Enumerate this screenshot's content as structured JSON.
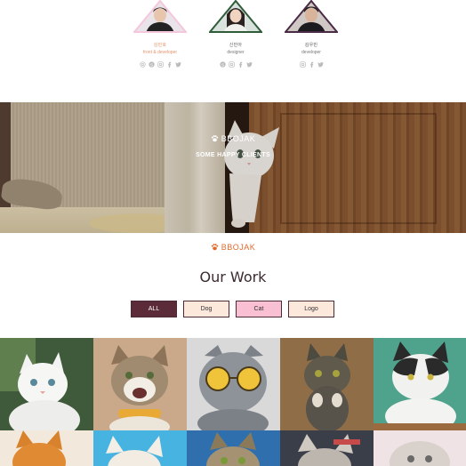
{
  "team": {
    "members": [
      {
        "name": "김민호",
        "role": "front & developer",
        "border": "#f4c7dc",
        "icons": [
          "instagram-icon",
          "skype-icon",
          "instagram-icon",
          "facebook-icon",
          "twitter-icon"
        ]
      },
      {
        "name": "신민아",
        "role": "designer",
        "border": "#2f5d3a",
        "icons": [
          "skype-icon",
          "instagram-icon",
          "facebook-icon",
          "twitter-icon"
        ]
      },
      {
        "name": "김우빈",
        "role": "developer",
        "border": "#4a2b46",
        "icons": [
          "instagram-icon",
          "facebook-icon",
          "twitter-icon"
        ]
      }
    ]
  },
  "hero": {
    "brand": "BBOJAK",
    "subtitle": "SOME HAPPY CLIENTS"
  },
  "work": {
    "brand": "BBOJAK",
    "title": "Our Work",
    "filters": [
      {
        "label": "ALL",
        "active": true
      },
      {
        "label": "Dog",
        "active": false
      },
      {
        "label": "Cat",
        "active": false
      },
      {
        "label": "Logo",
        "active": false
      }
    ]
  },
  "colors": {
    "accent": "#e06a2c",
    "filter_active": "#5b2b3a",
    "filter_peach": "#fde8dc",
    "filter_pink": "#f9c0d3"
  }
}
